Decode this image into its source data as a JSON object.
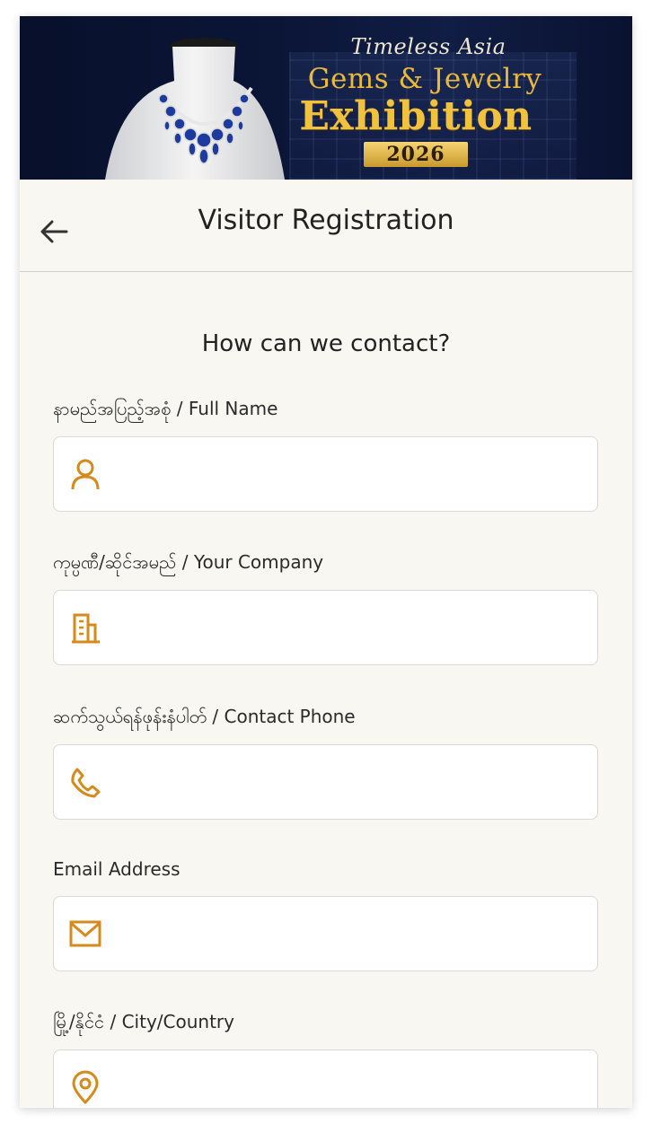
{
  "banner": {
    "line1": "Timeless Asia",
    "line2": "Gems & Jewelry",
    "line3": "Exhibition",
    "year": "2026"
  },
  "header": {
    "title": "Visitor Registration",
    "back_icon": "arrow-left-icon"
  },
  "form": {
    "heading": "How can we contact?",
    "fields": [
      {
        "label": "နာမည်အပြည့်အစုံ / Full Name",
        "icon": "user-icon",
        "value": "",
        "placeholder": ""
      },
      {
        "label": "ကုမ္ပဏီ/ဆိုင်အမည် / Your Company",
        "icon": "building-icon",
        "value": "",
        "placeholder": ""
      },
      {
        "label": "ဆက်သွယ်ရန်ဖုန်းနံပါတ် / Contact Phone",
        "icon": "phone-icon",
        "value": "",
        "placeholder": ""
      },
      {
        "label": "Email Address",
        "icon": "mail-icon",
        "value": "",
        "placeholder": ""
      },
      {
        "label": "မြို့/နိုင်ငံ / City/Country",
        "icon": "location-pin-icon",
        "value": "",
        "placeholder": ""
      }
    ]
  },
  "colors": {
    "accent": "#d68a1c",
    "page_bg": "#f8f7f2",
    "banner_gold": "#f1c23e",
    "banner_bg": "#0b1638"
  }
}
